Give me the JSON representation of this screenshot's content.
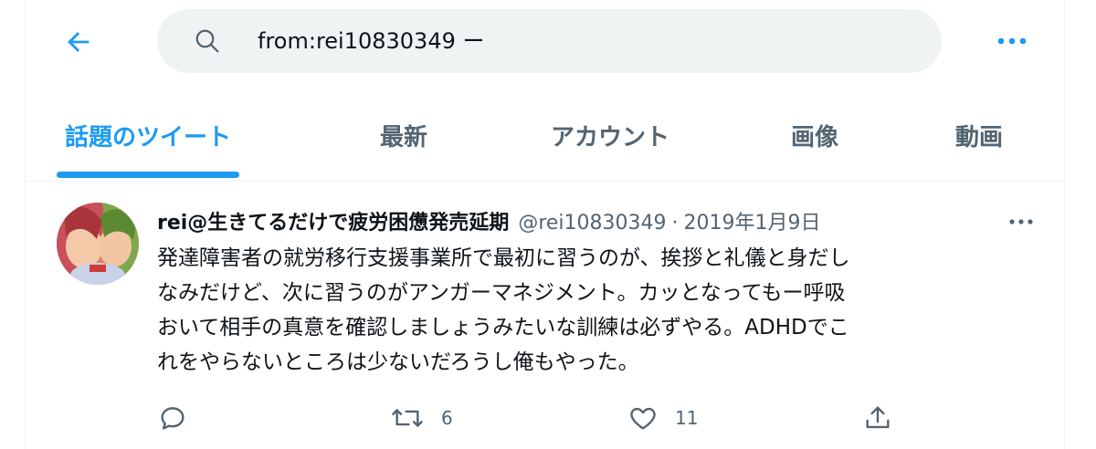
{
  "search": {
    "query": "from:rei10830349 ー"
  },
  "tabs": [
    {
      "label": "話題のツイート",
      "active": true
    },
    {
      "label": "最新",
      "active": false
    },
    {
      "label": "アカウント",
      "active": false
    },
    {
      "label": "画像",
      "active": false
    },
    {
      "label": "動画",
      "active": false
    }
  ],
  "tweet": {
    "author_name": "rei@生きてるだけで疲労困憊発売延期",
    "handle": "@rei10830349",
    "separator": "·",
    "date": "2019年1月9日",
    "text_lines": [
      "発達障害者の就労移行支援事業所で最初に習うのが、挨拶と礼儀と身だし",
      "なみだけど、次に習うのがアンガーマネジメント。カッとなってもー呼吸",
      "おいて相手の真意を確認しましょうみたいな訓練は必ずやる。ADHDでこ",
      "れをやらないところは少ないだろうし俺もやった。"
    ],
    "actions": {
      "reply_count": "",
      "retweet_count": "6",
      "like_count": "11"
    }
  },
  "colors": {
    "accent": "#1d9bf0",
    "text": "#0f1419",
    "secondary": "#536471",
    "search_bg": "#eff3f4"
  },
  "icons": [
    "back-arrow-icon",
    "search-icon",
    "more-icon",
    "reply-icon",
    "retweet-icon",
    "like-icon",
    "share-icon"
  ]
}
